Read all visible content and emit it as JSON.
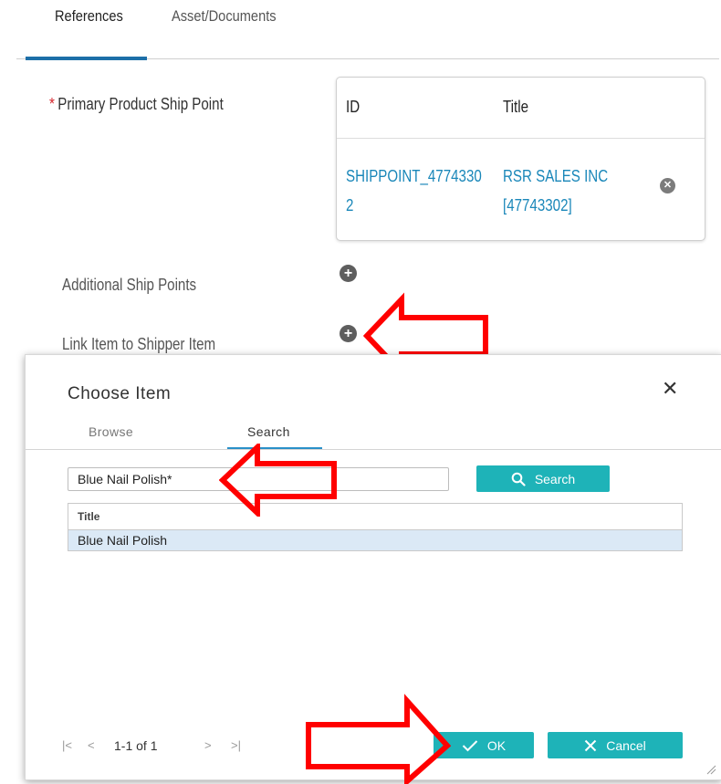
{
  "tabs": [
    {
      "label": "References"
    },
    {
      "label": "Asset/Documents"
    }
  ],
  "form": {
    "required_mark": "*",
    "primary_ship_point_label": "Primary Product Ship Point",
    "additional_ship_points_label": "Additional Ship Points",
    "link_item_label": "Link Item to Shipper Item"
  },
  "ship_point_table": {
    "headers": [
      "ID",
      "Title"
    ],
    "row": {
      "id_line1": "SHIPPOINT_4774330",
      "id_line2": "2",
      "title_line1": "RSR SALES INC",
      "title_line2": "[47743302]"
    },
    "remove_glyph": "✕"
  },
  "icons": {
    "plus": "+",
    "close": "✕",
    "search": "search-icon",
    "check": "check-icon",
    "cancel": "x-icon"
  },
  "modal": {
    "title": "Choose Item",
    "close_glyph": "✕",
    "tabs": [
      {
        "label": "Browse"
      },
      {
        "label": "Search"
      }
    ],
    "search_value": "Blue Nail Polish*",
    "search_button": "Search",
    "results": {
      "header": "Title",
      "rows": [
        "Blue Nail Polish"
      ]
    },
    "pager": {
      "first": "|<",
      "prev": "<",
      "info": "1-1 of 1",
      "next": ">",
      "last": ">|"
    },
    "ok_label": "OK",
    "cancel_label": "Cancel"
  },
  "colors": {
    "accent_teal": "#1eb3b8",
    "tab_active": "#1d6fa8",
    "link_blue": "#1a87b9",
    "required_red": "#d6232a",
    "annotation_arrow_red": "#ff0000"
  }
}
